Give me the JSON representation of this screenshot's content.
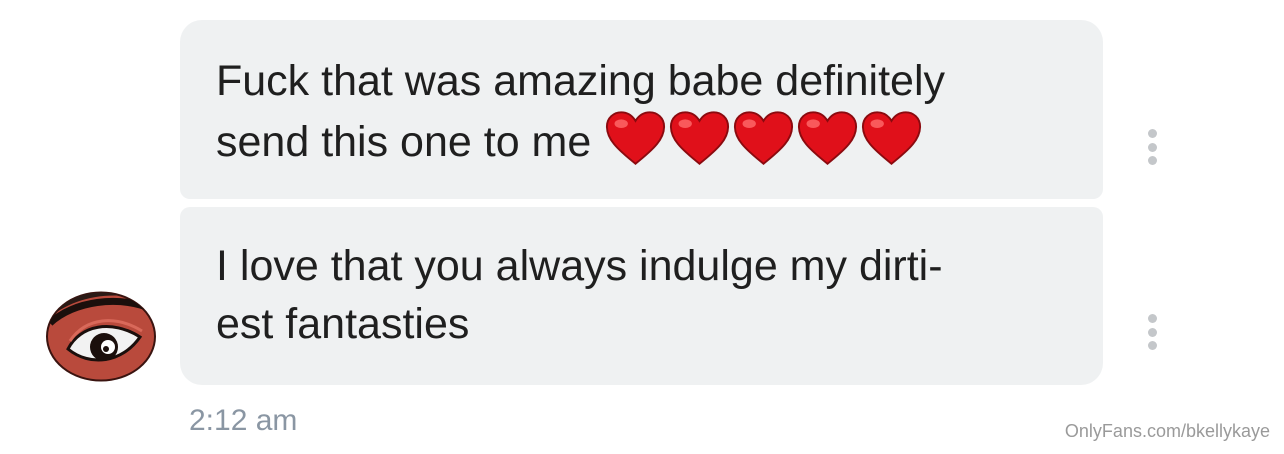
{
  "messages": [
    {
      "lines": [
        "Fuck that was amazing babe definitely",
        "send this one to me"
      ],
      "emoji": [
        "❤️",
        "❤️",
        "❤️",
        "❤️",
        "❤️"
      ],
      "menu_icon": "more-vertical-icon"
    },
    {
      "lines": [
        "I love that you always indulge my dirti-",
        "est fantasties"
      ],
      "menu_icon": "more-vertical-icon"
    }
  ],
  "timestamp": "2:12 am",
  "watermark": "OnlyFans.com/bkellykaye",
  "avatar": {
    "icon": "eye-avatar-icon"
  },
  "colors": {
    "bubble": "#eff1f2",
    "text": "#1f1f1f",
    "timestamp": "#8a96a3",
    "heart": "#e0101a",
    "dots": "#c4c7ca"
  }
}
